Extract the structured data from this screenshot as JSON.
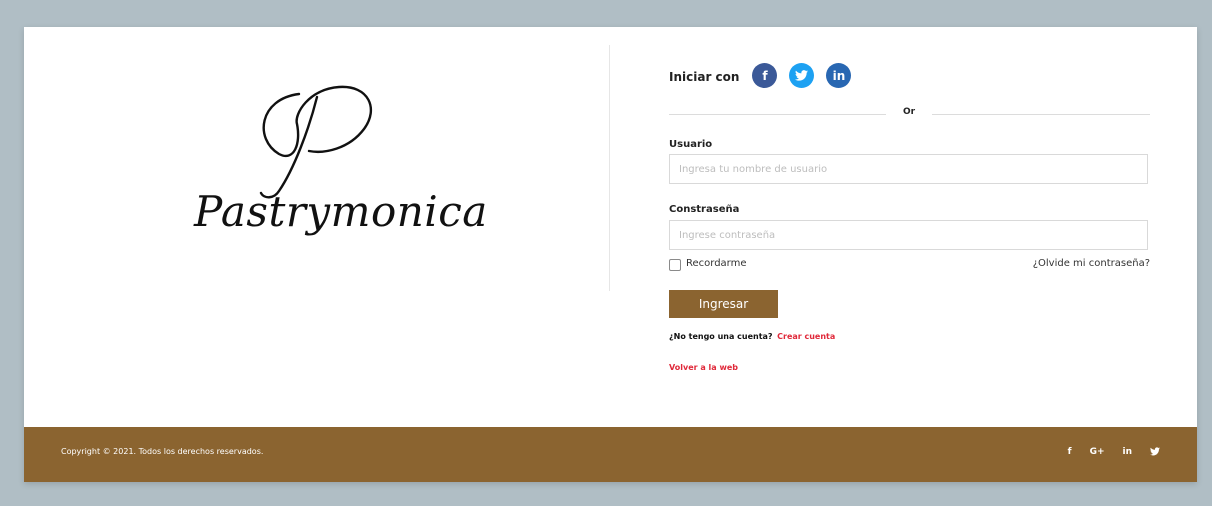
{
  "brand": {
    "name": "Pastrymonica",
    "monogram": "P",
    "color": "#8b6430"
  },
  "social_login": {
    "label": "Iniciar con",
    "buttons": [
      {
        "icon": "facebook-icon",
        "glyph": "f",
        "color": "#3b5998"
      },
      {
        "icon": "twitter-icon",
        "glyph": "t",
        "color": "#1da1f2"
      },
      {
        "icon": "linkedin-icon",
        "glyph": "in",
        "color": "#2867b2"
      }
    ]
  },
  "divider": {
    "text": "Or"
  },
  "username": {
    "label": "Usuario",
    "placeholder": "Ingresa tu nombre de usuario",
    "value": ""
  },
  "password": {
    "label": "Constraseña",
    "placeholder": "Ingrese contraseña",
    "value": ""
  },
  "remember": {
    "label": "Recordarme",
    "checked": false
  },
  "forgot": {
    "label": "¿Olvide mi contraseña?"
  },
  "submit": {
    "label": "Ingresar"
  },
  "signup": {
    "question": "¿No tengo una cuenta?",
    "link": "Crear cuenta"
  },
  "back": {
    "label": "Volver a la web"
  },
  "footer": {
    "copyright": "Copyright © 2021. Todos los derechos reservados.",
    "social": [
      {
        "icon": "facebook-icon",
        "glyph": "f"
      },
      {
        "icon": "google-plus-icon",
        "glyph": "G+"
      },
      {
        "icon": "linkedin-icon",
        "glyph": "in"
      },
      {
        "icon": "twitter-icon",
        "glyph": "t"
      }
    ]
  },
  "colors": {
    "background": "#b0bec5",
    "accent": "#8b6430",
    "link_red": "#e0293a"
  }
}
